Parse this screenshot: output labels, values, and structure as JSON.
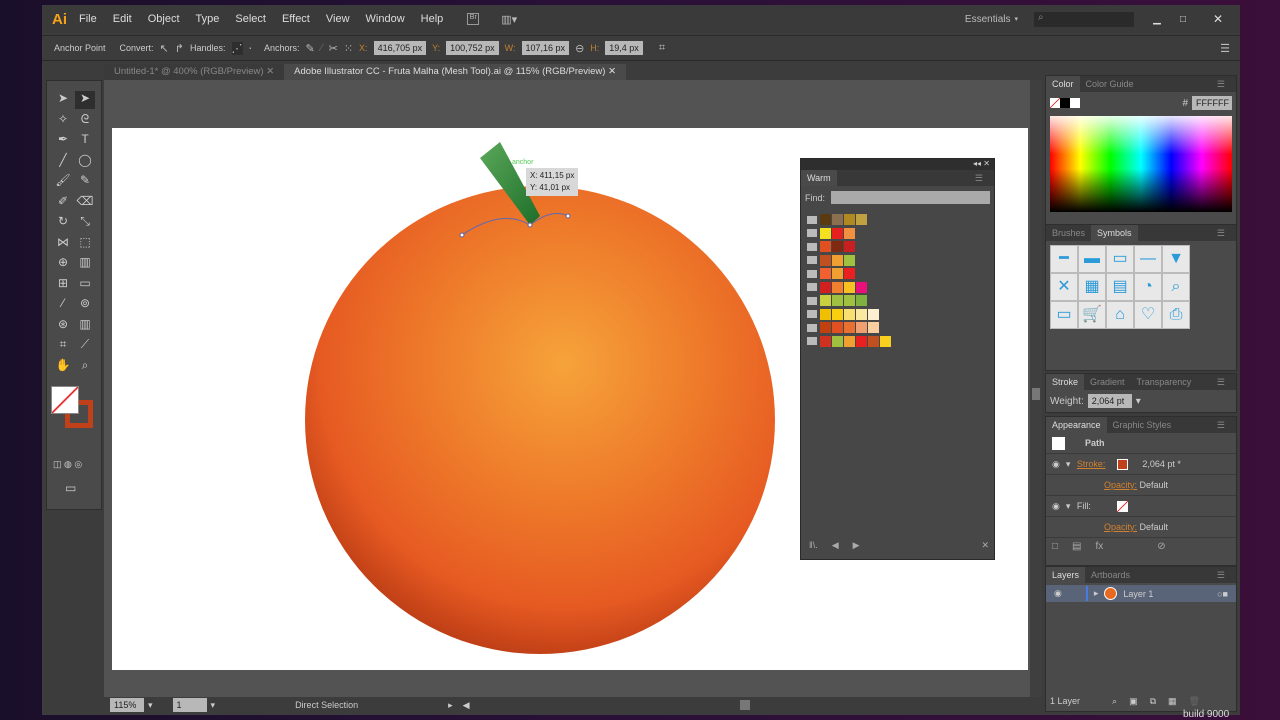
{
  "app": {
    "logo": "Ai",
    "menus": [
      "File",
      "Edit",
      "Object",
      "Type",
      "Select",
      "Effect",
      "View",
      "Window",
      "Help"
    ],
    "workspace": "Essentials",
    "search_placeholder": ""
  },
  "control": {
    "anchor_point": "Anchor Point",
    "convert": "Convert:",
    "handles": "Handles:",
    "anchors": "Anchors:",
    "x_label": "X:",
    "x": "416,705 px",
    "y_label": "Y:",
    "y": "100,752 px",
    "w_label": "W:",
    "w": "107,16 px",
    "h_label": "H:",
    "h": "19,4 px"
  },
  "tabs": [
    {
      "label": "Untitled-1* @ 400% (RGB/Preview)",
      "active": false
    },
    {
      "label": "Adobe Illustrator CC - Fruta Malha (Mesh Tool).ai @ 115% (RGB/Preview)",
      "active": true
    }
  ],
  "canvas": {
    "tooltip_x": "X: 411,15 px",
    "tooltip_y": "Y: 41,01 px",
    "anchor_hint": "anchor",
    "fruit_color": "#e85a20",
    "leaf_color": "#2f8a3a"
  },
  "warm": {
    "title": "Warm",
    "find_label": "Find:",
    "swatch_rows": [
      [
        "#5a3a10",
        "#8a7050",
        "#b08a20",
        "#c0a040"
      ],
      [
        "#f5e020",
        "#e82020",
        "#f09040"
      ],
      [
        "#e05020",
        "#802810",
        "#c82020"
      ],
      [
        "#c05020",
        "#f0a030",
        "#a0c040"
      ],
      [
        "#f06030",
        "#f0a030",
        "#e82020"
      ],
      [
        "#d02020",
        "#f08030",
        "#f8c020",
        "#e8107a"
      ],
      [
        "#c8d040",
        "#a0c040",
        "#a0c040",
        "#80b040"
      ],
      [
        "#f0c000",
        "#f8d010",
        "#f8e070",
        "#f8e8a0",
        "#fcf0d0"
      ],
      [
        "#c04010",
        "#e05020",
        "#e87030",
        "#f0a070",
        "#f8d0a0"
      ],
      [
        "#d03020",
        "#a0c040",
        "#f0a030",
        "#e82020",
        "#c05020",
        "#f8d020"
      ]
    ]
  },
  "color": {
    "tabs": [
      "Color",
      "Color Guide"
    ],
    "hex_label": "#",
    "hex": "FFFFFF"
  },
  "symbols": {
    "tabs": [
      "Brushes",
      "Symbols"
    ],
    "items": [
      "bar-1",
      "bar-2",
      "bar-3",
      "bar-4",
      "dropdown",
      "close",
      "calendar",
      "film",
      "rss",
      "search",
      "card",
      "cart",
      "home",
      "heart-plus",
      "printer"
    ]
  },
  "stroke": {
    "tabs": [
      "Stroke",
      "Gradient",
      "Transparency"
    ],
    "weight_label": "Weight:",
    "weight": "2,064 pt"
  },
  "appearance": {
    "tabs": [
      "Appearance",
      "Graphic Styles"
    ],
    "object": "Path",
    "stroke_label": "Stroke:",
    "stroke_value": "2,064 pt *",
    "stroke_color": "#c0401a",
    "opacity_label": "Opacity:",
    "opacity_value": "Default",
    "fill_label": "Fill:"
  },
  "layers": {
    "tabs": [
      "Layers",
      "Artboards"
    ],
    "layer_name": "Layer 1",
    "count": "1 Layer"
  },
  "status": {
    "zoom": "115%",
    "artboard": "1",
    "tool": "Direct Selection"
  },
  "overlay": {
    "build": "build 9000"
  }
}
